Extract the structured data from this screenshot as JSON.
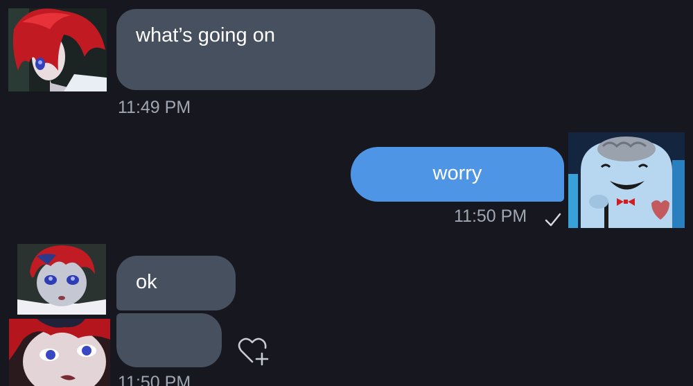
{
  "messages": [
    {
      "direction": "incoming",
      "text": "what’s going on",
      "time": "11:49 PM"
    },
    {
      "direction": "outgoing",
      "text": "worry",
      "time": "11:50 PM",
      "status_icon": "checkmark-icon"
    },
    {
      "direction": "incoming",
      "text": "ok"
    },
    {
      "direction": "incoming",
      "text": "",
      "time": "11:50 PM",
      "reaction_icon": "add-reaction-heart-icon"
    }
  ],
  "colors": {
    "background": "#17171f",
    "incoming_bubble": "#47505f",
    "outgoing_bubble": "#4f95e6",
    "timestamp": "#a1a7b2"
  }
}
